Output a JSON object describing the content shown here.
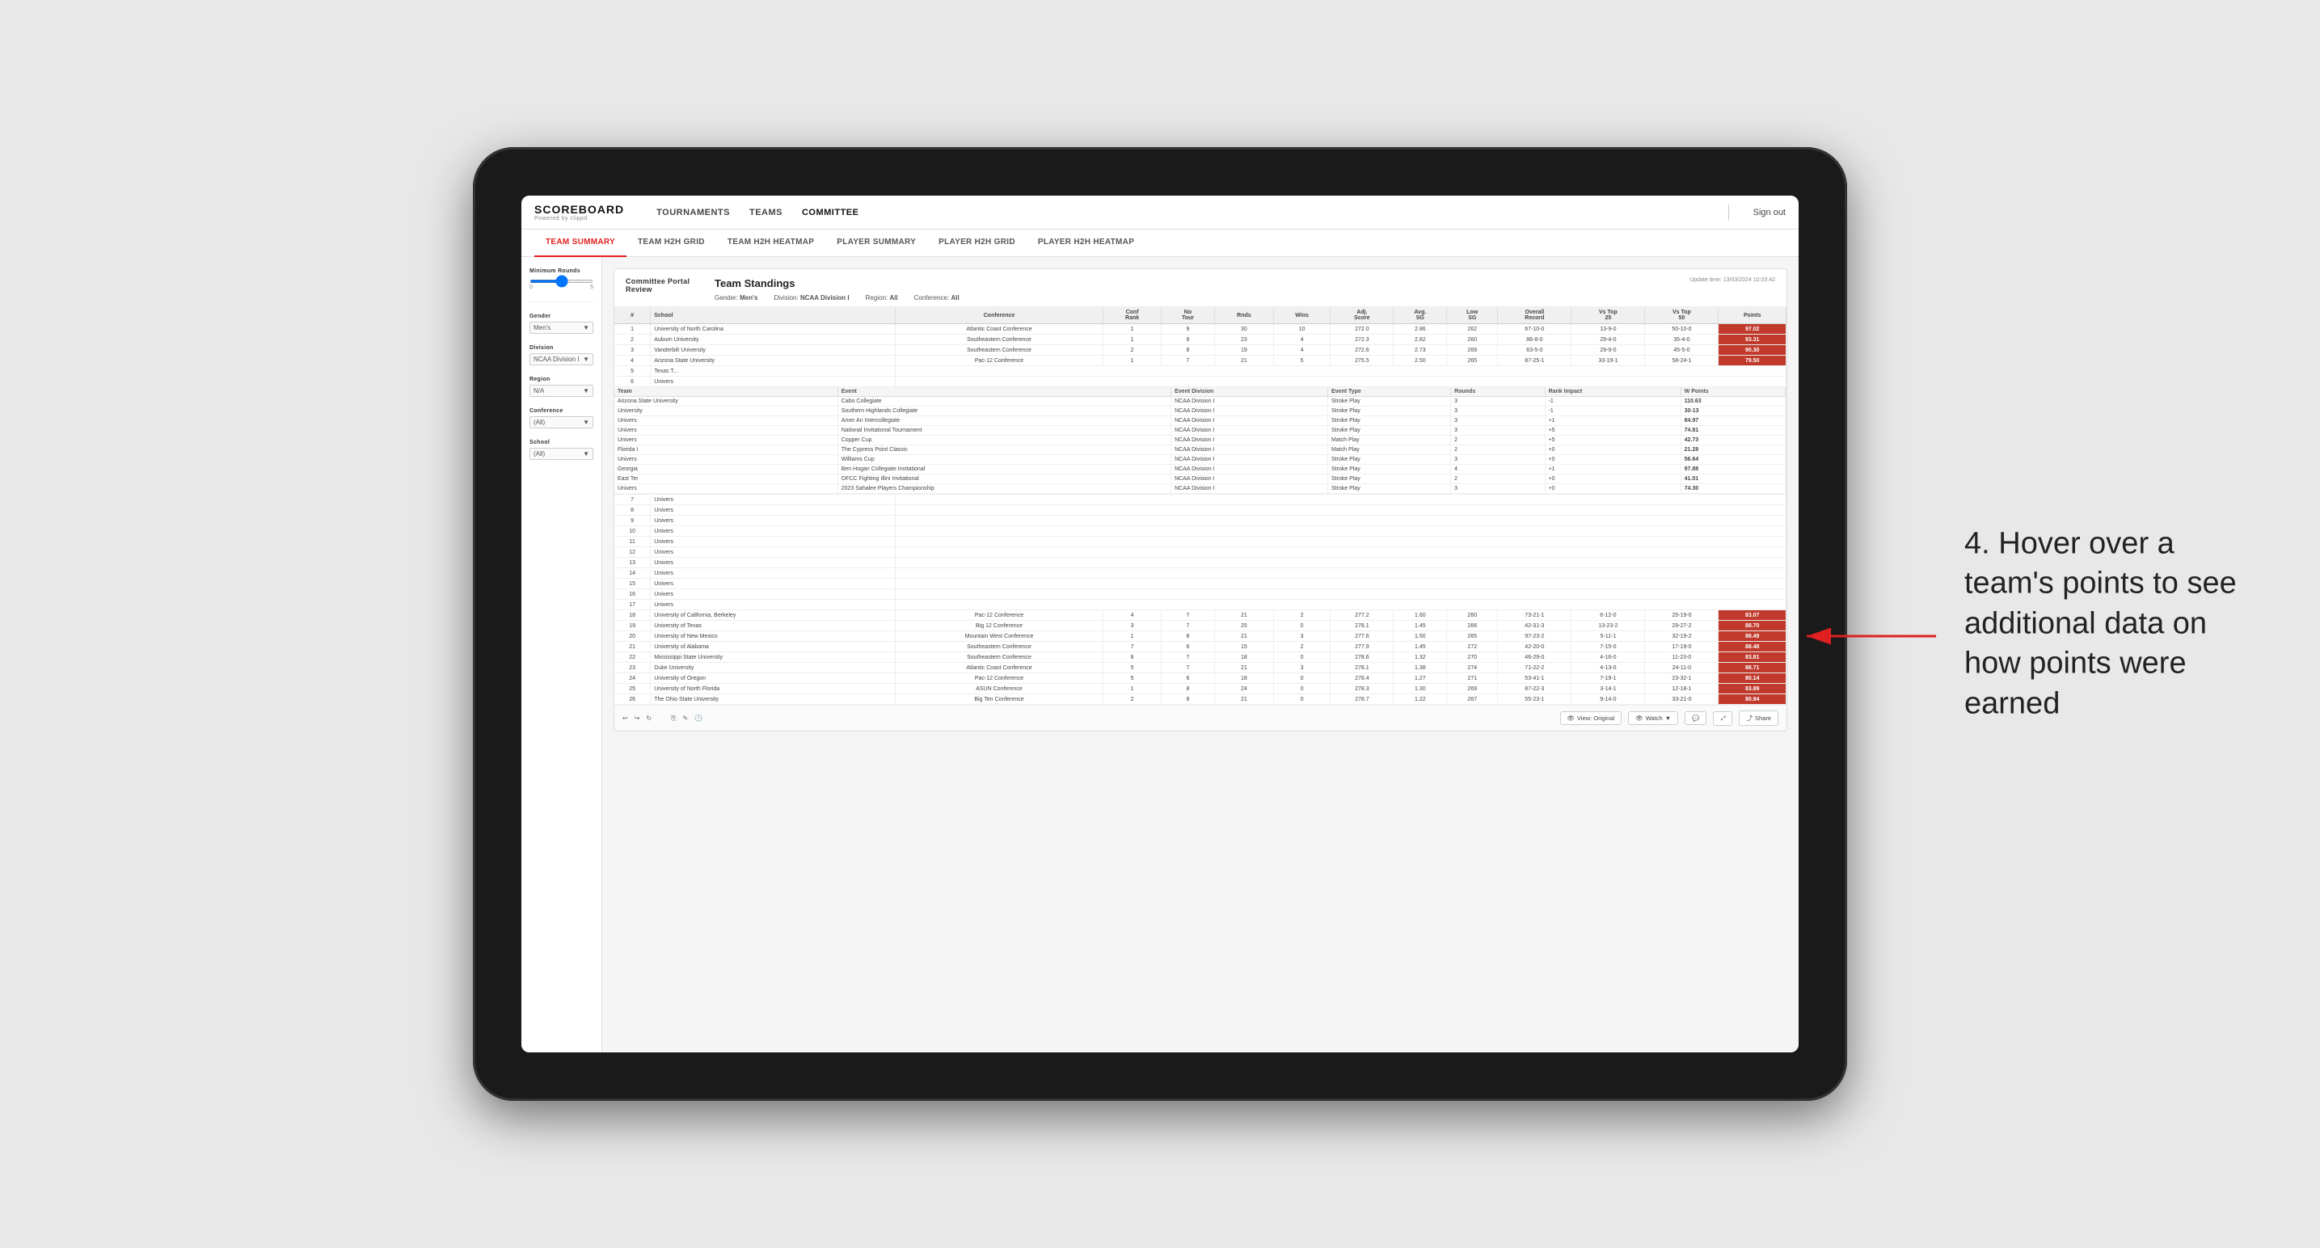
{
  "app": {
    "logo": "SCOREBOARD",
    "logo_sub": "Powered by clippd",
    "nav_items": [
      "TOURNAMENTS",
      "TEAMS",
      "COMMITTEE"
    ],
    "sign_out": "Sign out"
  },
  "sub_tabs": [
    "TEAM SUMMARY",
    "TEAM H2H GRID",
    "TEAM H2H HEATMAP",
    "PLAYER SUMMARY",
    "PLAYER H2H GRID",
    "PLAYER H2H HEATMAP"
  ],
  "active_sub_tab": "TEAM SUMMARY",
  "sidebar": {
    "min_rounds_label": "Minimum Rounds",
    "min_rounds_val": "5",
    "gender_label": "Gender",
    "gender_val": "Men's",
    "division_label": "Division",
    "division_val": "NCAA Division I",
    "region_label": "Region",
    "region_val": "N/A",
    "conference_label": "Conference",
    "conference_val": "(All)",
    "school_label": "School",
    "school_val": "(All)"
  },
  "report": {
    "portal_title": "Committee Portal Review",
    "standings_title": "Team Standings",
    "update_time": "Update time: 13/03/2024 10:03:42",
    "filters": {
      "gender_label": "Gender:",
      "gender_val": "Men's",
      "division_label": "Division:",
      "division_val": "NCAA Division I",
      "region_label": "Region:",
      "region_val": "All",
      "conference_label": "Conference:",
      "conference_val": "All"
    }
  },
  "table_headers": [
    "#",
    "School",
    "Conference",
    "Conf Rank",
    "No Tour",
    "Rnds",
    "Wins",
    "Adj. Score",
    "Avg. SG",
    "Low SG",
    "Overall Record",
    "Vs Top 25",
    "Vs Top 50",
    "Points"
  ],
  "main_rows": [
    {
      "rank": 1,
      "school": "University of North Carolina",
      "conf": "Atlantic Coast Conference",
      "conf_rank": 1,
      "no_tour": 9,
      "rnds": 30,
      "wins": 10,
      "adj_score": "272.0",
      "avg_sg": "2.86",
      "low_sg": "262",
      "overall": "67-10-0",
      "vs25": "13-9-0",
      "vs50": "50-10-0",
      "points": "97.02"
    },
    {
      "rank": 2,
      "school": "Auburn University",
      "conf": "Southeastern Conference",
      "conf_rank": 1,
      "no_tour": 9,
      "rnds": 23,
      "wins": 4,
      "adj_score": "272.3",
      "avg_sg": "2.82",
      "low_sg": "260",
      "overall": "86-8-0",
      "vs25": "29-4-0",
      "vs50": "35-4-0",
      "points": "93.31"
    },
    {
      "rank": 3,
      "school": "Vanderbilt University",
      "conf": "Southeastern Conference",
      "conf_rank": 2,
      "no_tour": 8,
      "rnds": 19,
      "wins": 4,
      "adj_score": "272.6",
      "avg_sg": "2.73",
      "low_sg": "269",
      "overall": "63-5-0",
      "vs25": "29-9-0",
      "vs50": "45-5-0",
      "points": "90.30"
    },
    {
      "rank": 4,
      "school": "Arizona State University",
      "conf": "Pac-12 Conference",
      "conf_rank": 1,
      "no_tour": 7,
      "rnds": 21,
      "wins": 5,
      "adj_score": "275.5",
      "avg_sg": "2.50",
      "low_sg": "265",
      "overall": "87-25-1",
      "vs25": "33-19-1",
      "vs50": "58-24-1",
      "points": "79.50"
    },
    {
      "rank": 5,
      "school": "Texas T...",
      "conf": "",
      "conf_rank": "",
      "no_tour": "",
      "rnds": "",
      "wins": "",
      "adj_score": "",
      "avg_sg": "",
      "low_sg": "",
      "overall": "",
      "vs25": "",
      "vs50": "",
      "points": ""
    },
    {
      "rank": 6,
      "school": "Univers",
      "conf": "",
      "conf_rank": "",
      "no_tour": "",
      "rnds": "",
      "wins": "",
      "adj_score": "",
      "avg_sg": "",
      "low_sg": "",
      "overall": "",
      "vs25": "",
      "vs50": "",
      "points": ""
    },
    {
      "rank": 18,
      "school": "University of California, Berkeley",
      "conf": "Pac-12 Conference",
      "conf_rank": 4,
      "no_tour": 7,
      "rnds": 21,
      "wins": 2,
      "adj_score": "277.2",
      "avg_sg": "1.60",
      "low_sg": "260",
      "overall": "73-21-1",
      "vs25": "6-12-0",
      "vs50": "25-19-0",
      "points": "83.07"
    },
    {
      "rank": 19,
      "school": "University of Texas",
      "conf": "Big 12 Conference",
      "conf_rank": 3,
      "no_tour": 7,
      "rnds": 25,
      "wins": 0,
      "adj_score": "278.1",
      "avg_sg": "1.45",
      "low_sg": "266",
      "overall": "42-31-3",
      "vs25": "13-23-2",
      "vs50": "29-27-2",
      "points": "88.70"
    },
    {
      "rank": 20,
      "school": "University of New Mexico",
      "conf": "Mountain West Conference",
      "conf_rank": 1,
      "no_tour": 8,
      "rnds": 21,
      "wins": 3,
      "adj_score": "277.6",
      "avg_sg": "1.50",
      "low_sg": "265",
      "overall": "97-23-2",
      "vs25": "5-11-1",
      "vs50": "32-19-2",
      "points": "88.49"
    },
    {
      "rank": 21,
      "school": "University of Alabama",
      "conf": "Southeastern Conference",
      "conf_rank": 7,
      "no_tour": 6,
      "rnds": 15,
      "wins": 2,
      "adj_score": "277.9",
      "avg_sg": "1.45",
      "low_sg": "272",
      "overall": "42-20-0",
      "vs25": "7-15-0",
      "vs50": "17-19-0",
      "points": "88.48"
    },
    {
      "rank": 22,
      "school": "Mississippi State University",
      "conf": "Southeastern Conference",
      "conf_rank": 8,
      "no_tour": 7,
      "rnds": 18,
      "wins": 0,
      "adj_score": "278.6",
      "avg_sg": "1.32",
      "low_sg": "270",
      "overall": "46-29-0",
      "vs25": "4-16-0",
      "vs50": "11-23-0",
      "points": "83.81"
    },
    {
      "rank": 23,
      "school": "Duke University",
      "conf": "Atlantic Coast Conference",
      "conf_rank": 5,
      "no_tour": 7,
      "rnds": 21,
      "wins": 3,
      "adj_score": "278.1",
      "avg_sg": "1.38",
      "low_sg": "274",
      "overall": "71-22-2",
      "vs25": "4-13-0",
      "vs50": "24-11-0",
      "points": "88.71"
    },
    {
      "rank": 24,
      "school": "University of Oregon",
      "conf": "Pac-12 Conference",
      "conf_rank": 5,
      "no_tour": 6,
      "rnds": 18,
      "wins": 0,
      "adj_score": "278.4",
      "avg_sg": "1.27",
      "low_sg": "271",
      "overall": "53-41-1",
      "vs25": "7-19-1",
      "vs50": "23-32-1",
      "points": "80.14"
    },
    {
      "rank": 25,
      "school": "University of North Florida",
      "conf": "ASUN Conference",
      "conf_rank": 1,
      "no_tour": 8,
      "rnds": 24,
      "wins": 0,
      "adj_score": "278.3",
      "avg_sg": "1.30",
      "low_sg": "269",
      "overall": "87-22-3",
      "vs25": "3-14-1",
      "vs50": "12-18-1",
      "points": "83.89"
    },
    {
      "rank": 26,
      "school": "The Ohio State University",
      "conf": "Big Ten Conference",
      "conf_rank": 2,
      "no_tour": 8,
      "rnds": 21,
      "wins": 0,
      "adj_score": "278.7",
      "avg_sg": "1.22",
      "low_sg": "267",
      "overall": "55-23-1",
      "vs25": "9-14-0",
      "vs50": "33-21-0",
      "points": "80.94"
    }
  ],
  "sub_table_headers": [
    "Team",
    "Event",
    "Event Division",
    "Event Type",
    "Rounds",
    "Rank Impact",
    "W Points"
  ],
  "sub_table_rows": [
    {
      "team": "Arizona State University",
      "event": "Cabo Collegiate",
      "event_div": "NCAA Division I",
      "event_type": "Stroke Play",
      "rounds": 3,
      "rank_impact": "-1",
      "w_points": "110.63"
    },
    {
      "team": "University",
      "event": "Southern Highlands Collegiate",
      "event_div": "NCAA Division I",
      "event_type": "Stroke Play",
      "rounds": 3,
      "rank_impact": "-1",
      "w_points": "30-13"
    },
    {
      "team": "Univers",
      "event": "Amer An Intercollegiate",
      "event_div": "NCAA Division I",
      "event_type": "Stroke Play",
      "rounds": 3,
      "rank_impact": "+1",
      "w_points": "84.97"
    },
    {
      "team": "Univers",
      "event": "National Invitational Tournament",
      "event_div": "NCAA Division I",
      "event_type": "Stroke Play",
      "rounds": 3,
      "rank_impact": "+5",
      "w_points": "74.81"
    },
    {
      "team": "Univers",
      "event": "Copper Cup",
      "event_div": "NCAA Division I",
      "event_type": "Match Play",
      "rounds": 2,
      "rank_impact": "+5",
      "w_points": "42.73"
    },
    {
      "team": "Florida I",
      "event": "The Cypress Point Classic",
      "event_div": "NCAA Division I",
      "event_type": "Match Play",
      "rounds": 2,
      "rank_impact": "+0",
      "w_points": "21.28"
    },
    {
      "team": "Univers",
      "event": "Williams Cup",
      "event_div": "NCAA Division I",
      "event_type": "Stroke Play",
      "rounds": 3,
      "rank_impact": "+0",
      "w_points": "56.64"
    },
    {
      "team": "Georgia",
      "event": "Ben Hogan Collegiate Invitational",
      "event_div": "NCAA Division I",
      "event_type": "Stroke Play",
      "rounds": 4,
      "rank_impact": "+1",
      "w_points": "97.88"
    },
    {
      "team": "East Ter",
      "event": "OFCC Fighting Illini Invitational",
      "event_div": "NCAA Division I",
      "event_type": "Stroke Play",
      "rounds": 2,
      "rank_impact": "+0",
      "w_points": "41.01"
    },
    {
      "team": "Univers",
      "event": "2023 Sahalee Players Championship",
      "event_div": "NCAA Division I",
      "event_type": "Stroke Play",
      "rounds": 3,
      "rank_impact": "+0",
      "w_points": "74.30"
    }
  ],
  "footer": {
    "view_label": "View: Original",
    "watch_label": "Watch",
    "share_label": "Share"
  },
  "annotation": {
    "text": "4. Hover over a team's points to see additional data on how points were earned"
  }
}
